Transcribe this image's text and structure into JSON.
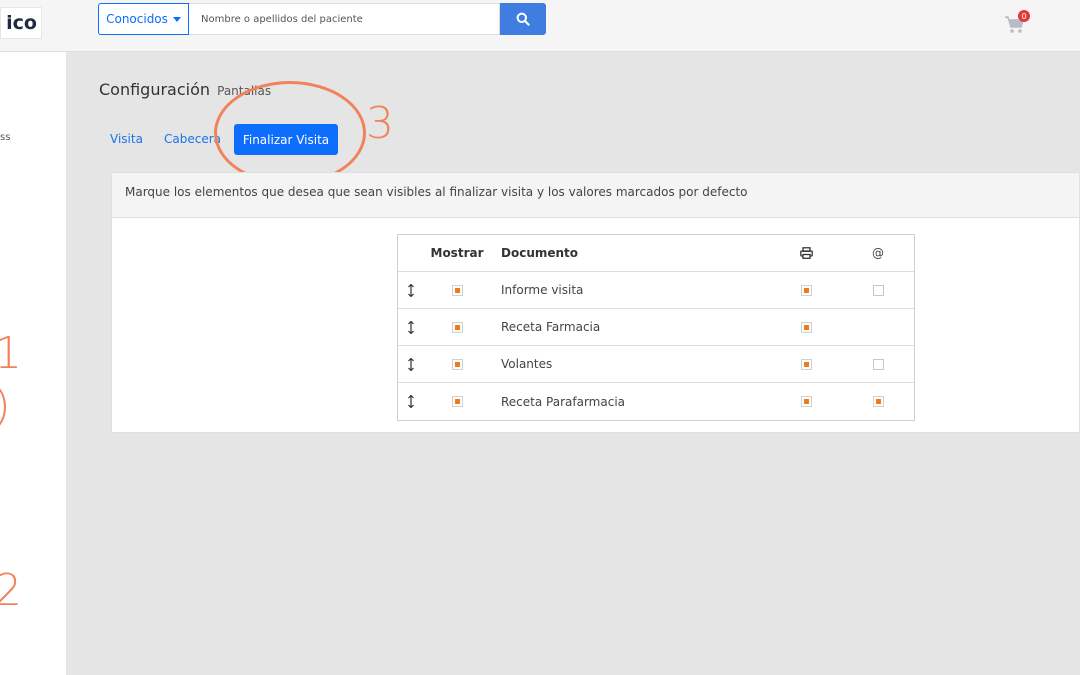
{
  "header": {
    "logo_text": "ico",
    "dropdown_label": "Conocidos",
    "search_placeholder": "Nombre o apellidos del paciente",
    "cart_count": "0"
  },
  "sidebar": {
    "fragment": "ss"
  },
  "annotations": {
    "one": "1",
    "two": "2",
    "three": "3"
  },
  "page": {
    "title": "Configuración",
    "subtitle": "Pantallas"
  },
  "tabs": [
    {
      "label": "Visita",
      "active": false
    },
    {
      "label": "Cabecera",
      "active": false
    },
    {
      "label": "Finalizar Visita",
      "active": true
    }
  ],
  "panel": {
    "description": "Marque los elementos que desea que sean visibles al finalizar visita y los valores marcados por defecto"
  },
  "table": {
    "headers": {
      "show": "Mostrar",
      "document": "Documento",
      "print_icon": "print-icon",
      "mail_icon": "@"
    },
    "rows": [
      {
        "name": "Informe visita",
        "show": true,
        "print": true,
        "mail": false,
        "mail_visible": true
      },
      {
        "name": "Receta Farmacia",
        "show": true,
        "print": true,
        "mail": false,
        "mail_visible": false
      },
      {
        "name": "Volantes",
        "show": true,
        "print": true,
        "mail": false,
        "mail_visible": true
      },
      {
        "name": "Receta Parafarmacia",
        "show": true,
        "print": true,
        "mail": true,
        "mail_visible": true
      }
    ]
  },
  "colors": {
    "accent": "#0d6efd",
    "annotation": "#f0835c",
    "checkbox_fill": "#f07a1a"
  }
}
